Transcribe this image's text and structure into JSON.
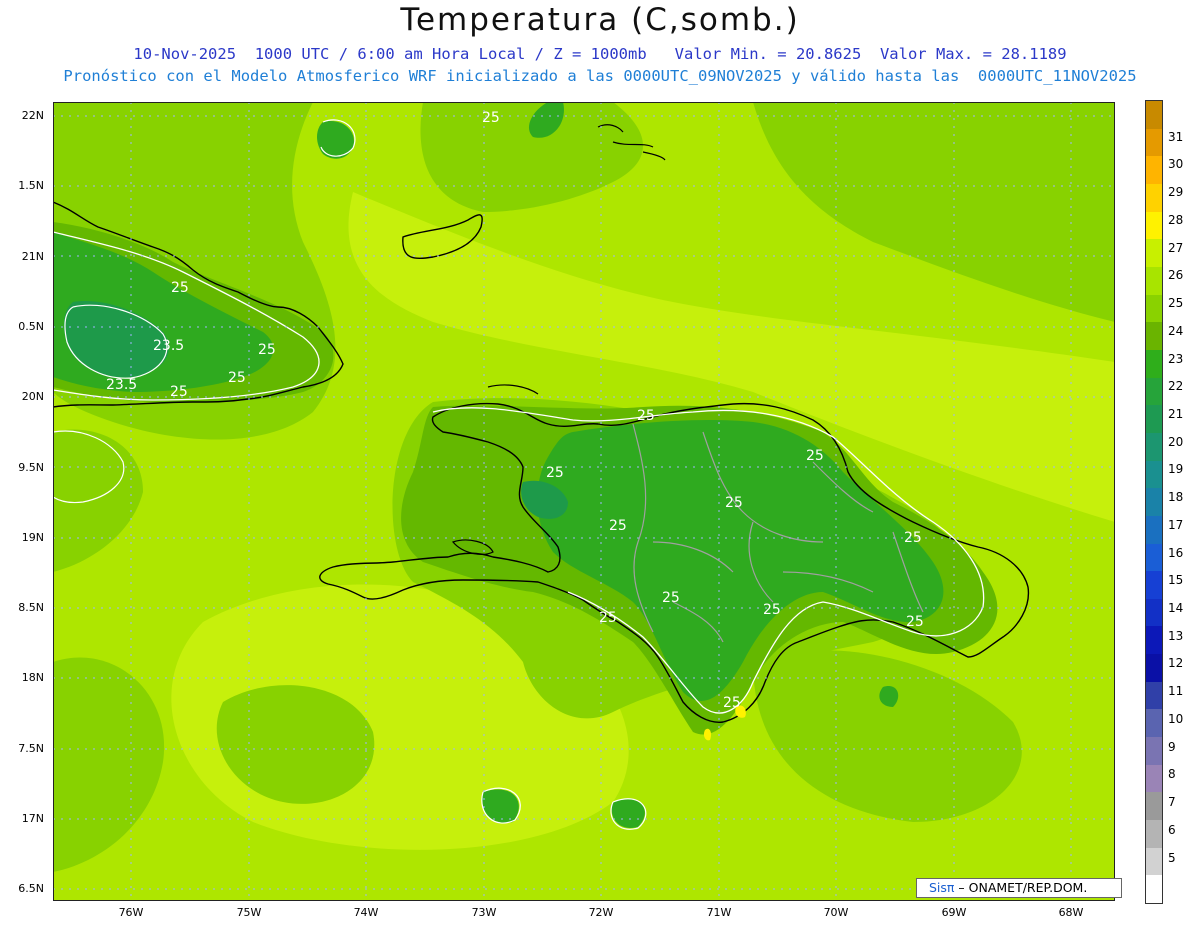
{
  "title": "Temperatura (C,somb.)",
  "subtitle1": "10-Nov-2025  1000 UTC / 6:00 am Hora Local / Z = 1000mb   Valor Min. = 20.8625  Valor Max. = 28.1189",
  "subtitle2": "Pronóstico con el Modelo Atmosferico WRF inicializado a las 0000UTC_09NOV2025 y válido hasta las  0000UTC_11NOV2025",
  "map": {
    "lat_labels": [
      "22N",
      "1.5N",
      "21N",
      "0.5N",
      "20N",
      "9.5N",
      "19N",
      "8.5N",
      "18N",
      "7.5N",
      "17N",
      "6.5N"
    ],
    "lon_labels": [
      "76W",
      "75W",
      "74W",
      "73W",
      "72W",
      "71W",
      "70W",
      "69W",
      "68W"
    ],
    "contour_labels": [
      {
        "text": "25"
      },
      {
        "text": "25"
      },
      {
        "text": "25"
      },
      {
        "text": "23.5"
      },
      {
        "text": "23.5"
      },
      {
        "text": "25"
      },
      {
        "text": "25"
      },
      {
        "text": "25"
      },
      {
        "text": "25"
      },
      {
        "text": "25"
      },
      {
        "text": "25"
      },
      {
        "text": "25"
      },
      {
        "text": "25"
      },
      {
        "text": "25"
      },
      {
        "text": "25"
      },
      {
        "text": "25"
      },
      {
        "text": "25"
      },
      {
        "text": "25"
      }
    ],
    "fill_colors": {
      "base": "#aee600",
      "light": "#c6f00c",
      "t26": "#88d200",
      "t25": "#64b800",
      "t24": "#2faa1f",
      "t23": "#1e9a4a"
    }
  },
  "colorbar": {
    "labels": [
      "31",
      "30",
      "29",
      "28",
      "27",
      "26",
      "25",
      "24",
      "23",
      "22",
      "21",
      "20",
      "19",
      "18",
      "17",
      "16",
      "15",
      "14",
      "13",
      "12",
      "11",
      "10",
      "9",
      "8",
      "7",
      "6",
      "5"
    ],
    "colors": [
      "#c88a00",
      "#e59a00",
      "#ffb400",
      "#ffd200",
      "#fff200",
      "#c8f000",
      "#a8e400",
      "#8ad200",
      "#6ab400",
      "#2fae1b",
      "#26a43a",
      "#1e9a52",
      "#1c9670",
      "#1a9090",
      "#1a82a8",
      "#1a70c0",
      "#1a5ed6",
      "#1640d4",
      "#1230c6",
      "#0c18b8",
      "#0a10a6",
      "#3040a8",
      "#5a64b0",
      "#7a74b2",
      "#9a84b6",
      "#9a9a9a",
      "#b4b4b4",
      "#d2d2d2",
      "#ffffff"
    ]
  },
  "logo": {
    "brand": "Sisπ",
    "text": " – ONAMET/REP.DOM."
  }
}
